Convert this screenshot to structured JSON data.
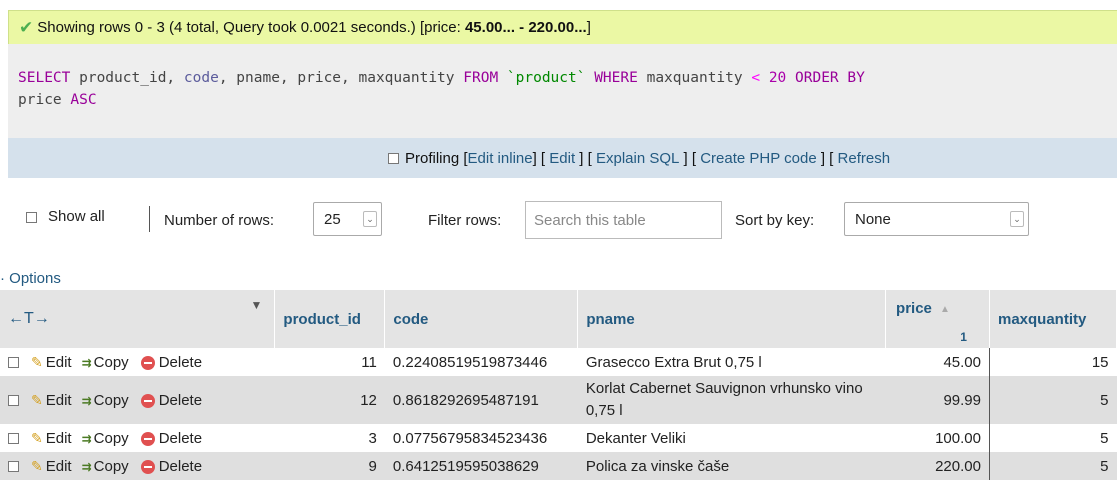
{
  "message": {
    "text_before": "Showing rows 0 - 3 (4 total, Query took 0.0021 seconds.) [price: ",
    "bold_range": "45.00... - 220.00...",
    "text_after": "]"
  },
  "sql": {
    "select": "SELECT",
    "col1": " product_id, ",
    "code": "code",
    "col2": ", pname, price, maxquantity ",
    "from": "FROM",
    "table": " `product` ",
    "where": "WHERE",
    "cond": " maxquantity ",
    "lt": "<",
    "num": " 20 ",
    "order": "ORDER BY",
    "order_col": "price",
    "asc": "ASC"
  },
  "sql_actions": {
    "profiling": "Profiling",
    "edit_inline": "Edit inline",
    "edit": "Edit",
    "explain": "Explain SQL",
    "php": "Create PHP code",
    "refresh": "Refresh"
  },
  "nav": {
    "show_all": "Show all",
    "number_of_rows_label": "Number of rows:",
    "number_of_rows_value": "25",
    "filter_label": "Filter rows:",
    "filter_placeholder": "Search this table",
    "sort_label": "Sort by key:",
    "sort_value": "None"
  },
  "options_link": "Options",
  "table": {
    "headers": {
      "product_id": "product_id",
      "code": "code",
      "pname": "pname",
      "price": "price",
      "price_sort_index": "1",
      "maxquantity": "maxquantity"
    },
    "action_labels": {
      "edit": "Edit",
      "copy": "Copy",
      "delete": "Delete"
    },
    "rows": [
      {
        "product_id": "11",
        "code": "0.22408519519873446",
        "pname": "Grasecco Extra Brut 0,75 l",
        "price": "45.00",
        "maxquantity": "15"
      },
      {
        "product_id": "12",
        "code": "0.8618292695487191",
        "pname": "Korlat Cabernet Sauvignon vrhunsko vino 0,75 l",
        "price": "99.99",
        "maxquantity": "5"
      },
      {
        "product_id": "3",
        "code": "0.07756795834523436",
        "pname": "Dekanter Veliki",
        "price": "100.00",
        "maxquantity": "5"
      },
      {
        "product_id": "9",
        "code": "0.6412519595038629",
        "pname": "Polica za vinske čaše",
        "price": "220.00",
        "maxquantity": "5"
      }
    ]
  }
}
